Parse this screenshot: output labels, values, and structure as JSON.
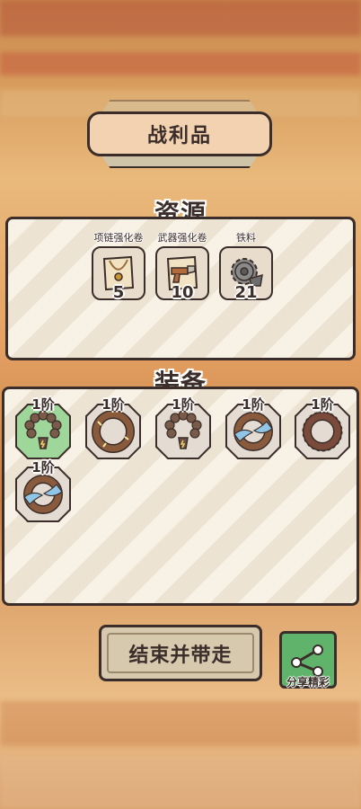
{
  "banner": {
    "title": "战利品"
  },
  "resources": {
    "title": "资源",
    "items": [
      {
        "name": "项链强化卷",
        "count": "5",
        "icon": "necklace-scroll-icon"
      },
      {
        "name": "武器强化卷",
        "count": "10",
        "icon": "weapon-scroll-icon"
      },
      {
        "name": "铁料",
        "count": "21",
        "icon": "iron-gear-icon"
      }
    ]
  },
  "equipment": {
    "title": "装备",
    "items": [
      {
        "level": "1阶",
        "icon": "bead-necklace-icon",
        "highlight": true
      },
      {
        "level": "1阶",
        "icon": "wooden-ring-icon",
        "highlight": false
      },
      {
        "level": "1阶",
        "icon": "bead-necklace-icon",
        "highlight": false
      },
      {
        "level": "1阶",
        "icon": "water-ring-icon",
        "highlight": false
      },
      {
        "level": "1阶",
        "icon": "spiked-ring-icon",
        "highlight": false
      },
      {
        "level": "1阶",
        "icon": "water-ring-icon",
        "highlight": false
      }
    ]
  },
  "buttons": {
    "finish": "结束并带走",
    "share": "分享精彩"
  },
  "colors": {
    "outline": "#3b2e2a",
    "highlight": "#9fd69a",
    "share": "#5fb36a"
  }
}
